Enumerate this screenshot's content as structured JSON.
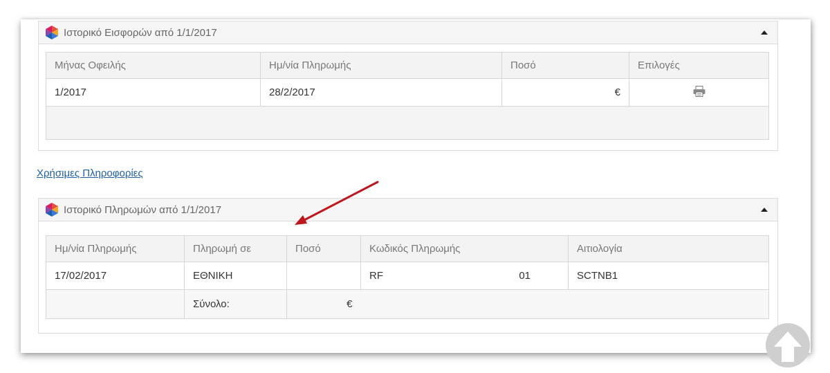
{
  "contributions": {
    "title": "Ιστορικό Εισφορών από 1/1/2017",
    "headers": [
      "Μήνας Οφειλής",
      "Ημ/νία Πληρωμής",
      "Ποσό",
      "Επιλογές"
    ],
    "rows": [
      {
        "month": "1/2017",
        "date": "28/2/2017",
        "amount": "€"
      }
    ]
  },
  "useful_info_link": "Χρήσιμες Πληροφορίες",
  "payments": {
    "title": "Ιστορικό Πληρωμών από 1/1/2017",
    "headers": [
      "Ημ/νία Πληρωμής",
      "Πληρωμή σε",
      "Ποσό",
      "Κωδικός Πληρωμής",
      "Αιτιολογία"
    ],
    "rows": [
      {
        "date": "17/02/2017",
        "bank": "ΕΘΝΙΚΗ",
        "amount": "",
        "code_start": "RF",
        "code_end": "01",
        "reason": "SCTNB1"
      }
    ],
    "total_label": "Σύνολο:",
    "total_amount": "€"
  },
  "colors": {
    "link": "#1f5fa8",
    "arrow": "#c0151b"
  }
}
